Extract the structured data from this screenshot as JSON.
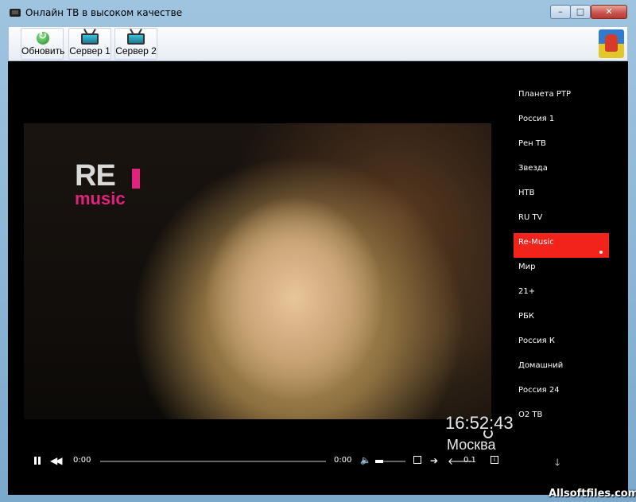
{
  "window": {
    "title": "Онлайн ТВ в высоком качестве",
    "close_glyph": "✕",
    "minimize_glyph": "–",
    "maximize_glyph": "□"
  },
  "toolbar": {
    "buttons": [
      {
        "label": "Обновить",
        "icon": "refresh-icon"
      },
      {
        "label": "Сервер 1",
        "icon": "tv-icon"
      },
      {
        "label": "Сервер 2",
        "icon": "tv-icon"
      }
    ],
    "logo_icon": "coat-of-arms-icon"
  },
  "video": {
    "logo_main": "RE",
    "logo_sub": "music",
    "clock": "16:52:43",
    "city": "Москва"
  },
  "channels": [
    "Планета РТР",
    "Россия 1",
    "Рен ТВ",
    "Звезда",
    "НТВ",
    "RU TV",
    "Re-Music",
    "Мир",
    "21+",
    "РБК",
    "Россия К",
    "Домашний",
    "Россия 24",
    "О2 ТВ"
  ],
  "active_channel": "Re-Music",
  "controls": {
    "time_current": "0:00",
    "time_total": "0:00",
    "rate": "0.1",
    "rewind_glyph": "◀◀",
    "next_glyph": "➔",
    "back_glyph": "🡐",
    "down_glyph": "🡓",
    "volume_glyph": "🔈",
    "info_glyph": "i"
  },
  "colors": {
    "active_channel_bg": "#f2231a",
    "logo_accent": "#e0247e"
  },
  "watermark": "Allsoftfiles.com"
}
